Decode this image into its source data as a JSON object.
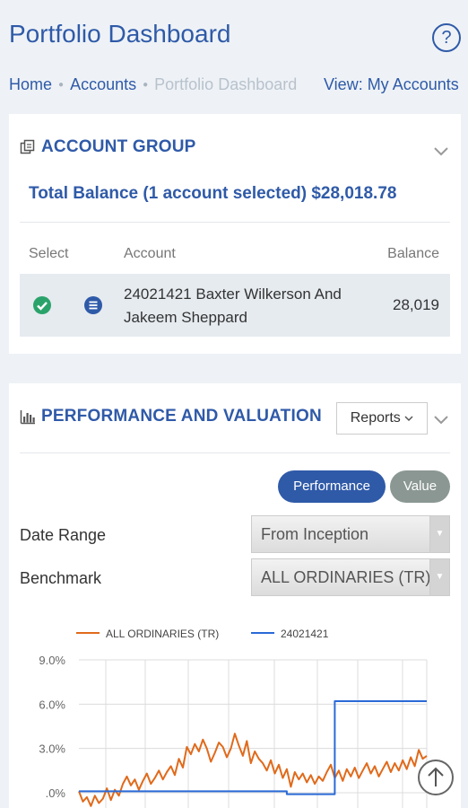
{
  "header": {
    "title": "Portfolio Dashboard",
    "help_label": "?"
  },
  "breadcrumb": {
    "items": [
      "Home",
      "Accounts",
      "Portfolio Dashboard"
    ],
    "view_link": "View: My Accounts"
  },
  "account_group": {
    "title": "ACCOUNT GROUP",
    "total_balance": "Total Balance (1 account selected) $28,018.78",
    "columns": {
      "select": "Select",
      "account": "Account",
      "balance": "Balance"
    },
    "rows": [
      {
        "account": "24021421  Baxter Wilkerson And Jakeem Sheppard",
        "balance": "28,019",
        "selected": true
      }
    ]
  },
  "performance": {
    "title": "PERFORMANCE AND VALUATION",
    "reports_label": "Reports",
    "toggle": {
      "performance": "Performance",
      "value": "Value",
      "active": "performance"
    },
    "date_range": {
      "label": "Date Range",
      "value": "From Inception"
    },
    "benchmark": {
      "label": "Benchmark",
      "value": "ALL ORDINARIES (TR)"
    }
  },
  "colors": {
    "primary": "#2f5aa8",
    "benchmark_line": "#e06a1b",
    "account_line": "#2a6ad8",
    "check_green": "#2aa36b",
    "pill_gray": "#8a9793"
  },
  "chart_data": {
    "type": "line",
    "y_ticks": [
      "9.0%",
      "6.0%",
      "3.0%",
      ".0%"
    ],
    "ylim": [
      -1,
      9
    ],
    "grid": true,
    "legend_position": "top",
    "series": [
      {
        "name": "ALL ORDINARIES (TR)",
        "values": [
          0.1,
          -0.6,
          -0.3,
          -0.9,
          -0.2,
          -0.7,
          -0.4,
          0.3,
          -0.5,
          0.2,
          -0.2,
          0.6,
          1.1,
          0.5,
          0.9,
          0.2,
          0.8,
          1.3,
          0.6,
          1.0,
          1.5,
          0.9,
          1.4,
          1.8,
          1.2,
          2.3,
          1.7,
          3.1,
          2.6,
          3.3,
          2.8,
          3.6,
          3.0,
          2.1,
          2.7,
          3.4,
          3.1,
          2.4,
          3.0,
          4.0,
          3.2,
          2.5,
          3.5,
          2.0,
          2.8,
          2.3,
          2.0,
          1.5,
          2.2,
          1.3,
          1.9,
          1.0,
          1.6,
          0.4,
          1.4,
          0.9,
          1.3,
          0.7,
          1.2,
          0.6,
          1.1,
          0.8,
          1.4,
          1.9,
          1.0,
          1.5,
          0.8,
          1.6,
          1.1,
          1.7,
          1.0,
          1.5,
          2.0,
          1.3,
          1.8,
          1.1,
          1.6,
          2.1,
          1.4,
          2.0,
          1.5,
          2.2,
          1.6,
          2.4,
          1.8,
          2.9,
          2.3,
          2.5
        ]
      },
      {
        "name": "24021421",
        "values": [
          0.1,
          0.1,
          0.1,
          0.1,
          0.1,
          0.1,
          0.1,
          0.1,
          0.1,
          0.1,
          0.1,
          0.1,
          0.1,
          0.1,
          0.1,
          0.1,
          0.1,
          0.1,
          0.1,
          0.1,
          0.1,
          0.1,
          0.1,
          0.1,
          0.1,
          0.1,
          0.1,
          0.1,
          0.1,
          0.1,
          0.1,
          0.1,
          0.1,
          0.1,
          0.1,
          0.1,
          0.1,
          0.1,
          0.1,
          0.1,
          0.1,
          0.1,
          0.1,
          0.1,
          0.1,
          0.1,
          0.1,
          0.1,
          0.1,
          0.1,
          0.1,
          0.1,
          -0.1,
          -0.1,
          -0.1,
          -0.1,
          -0.1,
          -0.1,
          -0.1,
          -0.1,
          -0.1,
          -0.1,
          -0.1,
          -0.1,
          6.2,
          6.2,
          6.2,
          6.2,
          6.2,
          6.2,
          6.2,
          6.2,
          6.2,
          6.2,
          6.2,
          6.2,
          6.2,
          6.2,
          6.2,
          6.2,
          6.2,
          6.2,
          6.2,
          6.2,
          6.2,
          6.2,
          6.2,
          6.2
        ]
      }
    ]
  }
}
